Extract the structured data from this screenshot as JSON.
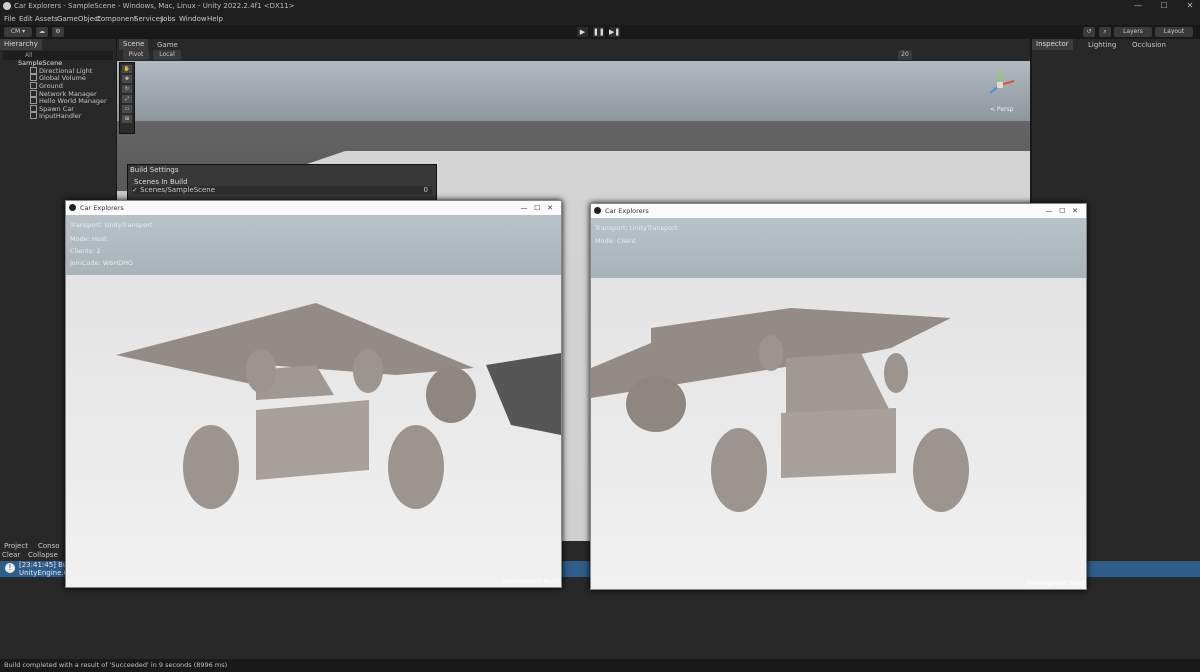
{
  "window": {
    "title": "Car Explorers - SampleScene - Windows, Mac, Linux - Unity 2022.2.4f1 <DX11>",
    "controls": [
      "—",
      "☐",
      "✕"
    ]
  },
  "menu": [
    "File",
    "Edit",
    "Assets",
    "GameObject",
    "Component",
    "Services",
    "Jobs",
    "Window",
    "Help"
  ],
  "toolbar": {
    "account": "CM ▾",
    "layers": "Layers",
    "layout": "Layout",
    "play": "▶",
    "pause": "❚❚",
    "step": "▶❚"
  },
  "hierarchy": {
    "title": "Hierarchy",
    "search": "All",
    "scene": "SampleScene",
    "items": [
      "Directional Light",
      "Global Volume",
      "Ground",
      "Network Manager",
      "Hello World Manager",
      "Spawn Car",
      "InputHandler"
    ]
  },
  "scene_view": {
    "tabs": [
      "Scene",
      "Game"
    ],
    "pivot": "Pivot",
    "local": "Local",
    "persp": "< Persp",
    "gizmo_count": "20"
  },
  "build_settings": {
    "title": "Build Settings",
    "scenes_label": "Scenes In Build",
    "scene": "Scenes/SampleScene",
    "index": "0"
  },
  "inspector": {
    "tabs": [
      "Inspector",
      "Lighting",
      "Occlusion"
    ]
  },
  "bottom": {
    "tabs": [
      "Project",
      "Conso"
    ],
    "clear": "Clear",
    "collapse": "Collapse",
    "console_line1": "[23:41:45] Build",
    "console_line2": "UnityEngine.GUI"
  },
  "status": "Build completed with a result of 'Succeeded' in 9 seconds (8996 ms)",
  "game_windows": [
    {
      "title": "Car Explorers",
      "hud": [
        "Transport: UnityTransport",
        "Mode: Host",
        "Clients: 2",
        "JoinCode: W6HDHG"
      ],
      "dev": "Development Build"
    },
    {
      "title": "Car Explorers",
      "hud": [
        "Transport: UnityTransport",
        "Mode: Client"
      ],
      "dev": "Development Build"
    }
  ]
}
